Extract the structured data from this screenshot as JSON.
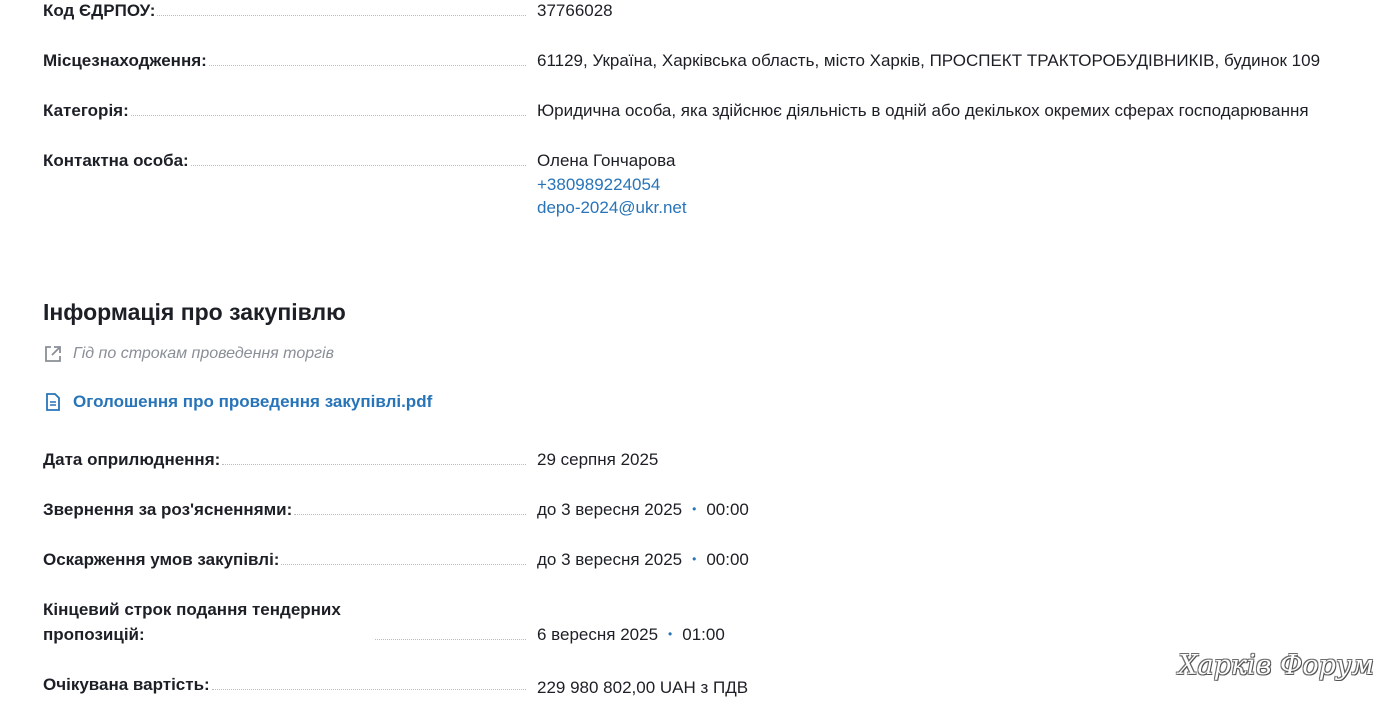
{
  "org": {
    "edrpou": {
      "label": "Код ЄДРПОУ:",
      "value": "37766028"
    },
    "location": {
      "label": "Місцезнаходження:",
      "value": "61129, Україна, Харківська область, місто Харків, ПРОСПЕКТ ТРАКТОРОБУДІВНИКІВ, будинок 109"
    },
    "category": {
      "label": "Категорія:",
      "value": "Юридична особа, яка здійснює діяльність в одній або декількох окремих сферах господарювання"
    },
    "contact": {
      "label": "Контактна особа:",
      "name": "Олена Гончарова",
      "phone": "+380989224054",
      "email": "depo-2024@ukr.net"
    }
  },
  "procurement": {
    "title": "Інформація про закупівлю",
    "guide_link": "Гід по строкам проведення торгів",
    "document_link": "Оголошення про проведення закупівлі.pdf",
    "published": {
      "label": "Дата оприлюднення:",
      "value": "29 серпня 2025"
    },
    "clarifications": {
      "label": "Звернення за роз'ясненнями:",
      "date": "до 3 вересня 2025",
      "time": "00:00"
    },
    "appeals": {
      "label": "Оскарження умов закупівлі:",
      "date": "до 3 вересня 2025",
      "time": "00:00"
    },
    "deadline": {
      "label": "Кінцевий строк подання тендерних пропозицій:",
      "date": "6 вересня 2025",
      "time": "01:00"
    },
    "expected_value": {
      "label": "Очікувана вартість:",
      "value": "229 980 802,00 UAH з ПДВ"
    }
  },
  "separator_glyph": "•",
  "watermark": "Харків Форум",
  "icons": {
    "guide": "external-link-icon",
    "document": "document-icon"
  },
  "colors": {
    "link": "#2874b8",
    "text": "#1d1f26",
    "muted": "#8a8e96"
  }
}
